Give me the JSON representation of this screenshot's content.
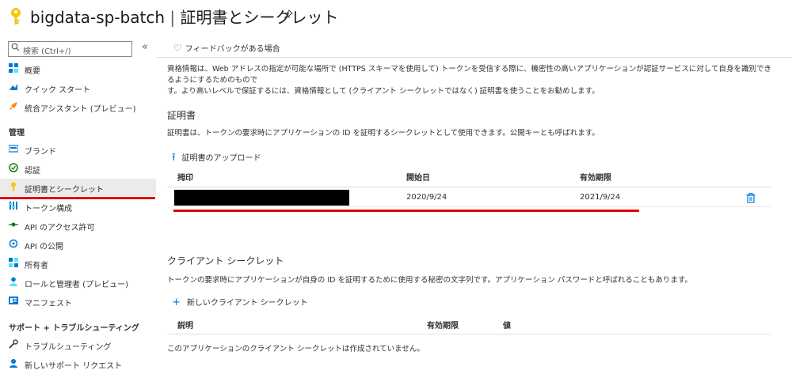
{
  "header": {
    "resource_name": "bigdata-sp-batch",
    "separator": "|",
    "page_name": "証明書とシークレット"
  },
  "sidebar": {
    "search_placeholder": "検索 (Ctrl+/)",
    "collapse_glyph": "«",
    "items_top": [
      {
        "label": "概要",
        "icon": "overview-icon"
      },
      {
        "label": "クイック スタート",
        "icon": "quickstart-icon"
      },
      {
        "label": "統合アシスタント (プレビュー)",
        "icon": "rocket-icon"
      }
    ],
    "section_manage": "管理",
    "items_manage": [
      {
        "label": "ブランド",
        "icon": "branding-icon"
      },
      {
        "label": "認証",
        "icon": "authentication-icon"
      },
      {
        "label": "証明書とシークレット",
        "icon": "key-icon",
        "active": true
      },
      {
        "label": "トークン構成",
        "icon": "token-icon"
      },
      {
        "label": "API のアクセス許可",
        "icon": "api-permissions-icon"
      },
      {
        "label": "API の公開",
        "icon": "expose-api-icon"
      },
      {
        "label": "所有者",
        "icon": "owners-icon"
      },
      {
        "label": "ロールと管理者 (プレビュー)",
        "icon": "roles-icon"
      },
      {
        "label": "マニフェスト",
        "icon": "manifest-icon"
      }
    ],
    "section_support": "サポート + トラブルシューティング",
    "items_support": [
      {
        "label": "トラブルシューティング",
        "icon": "wrench-icon"
      },
      {
        "label": "新しいサポート リクエスト",
        "icon": "support-icon"
      }
    ]
  },
  "main": {
    "feedback": "フィードバックがある場合",
    "description_line1": "資格情報は、Web アドレスの指定が可能な場所で (HTTPS スキーマを使用して) トークンを受信する際に、機密性の高いアプリケーションが認証サービスに対して自身を識別できるようにするためのもので",
    "description_line2": "す。より高いレベルで保証するには、資格情報として (クライアント シークレットではなく) 証明書を使うことをお勧めします。",
    "certificates": {
      "title": "証明書",
      "description": "証明書は、トークンの要求時にアプリケーションの ID を証明するシークレットとして使用できます。公開キーとも呼ばれます。",
      "upload_label": "証明書のアップロード",
      "columns": [
        "拇印",
        "開始日",
        "有効期限"
      ],
      "rows": [
        {
          "thumbprint": "",
          "start": "2020/9/24",
          "expires": "2021/9/24"
        }
      ]
    },
    "client_secrets": {
      "title": "クライアント シークレット",
      "description": "トークンの要求時にアプリケーションが自身の ID を証明するために使用する秘密の文字列です。アプリケーション パスワードと呼ばれることもあります。",
      "new_label": "新しいクライアント シークレット",
      "columns": [
        "説明",
        "有効期限",
        "値"
      ],
      "empty_message": "このアプリケーションのクライアント シークレットは作成されていません。"
    }
  },
  "colors": {
    "accent": "#0078d4",
    "highlight_red": "#e00000",
    "key_yellow": "#f2c811"
  }
}
